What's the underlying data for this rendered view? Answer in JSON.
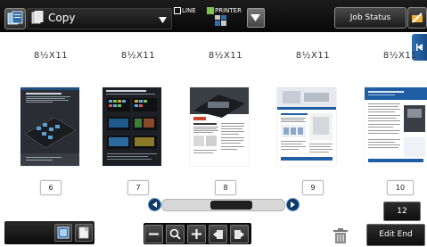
{
  "header": {
    "mode_label": "Copy",
    "line_label": "LINE",
    "printer_label": "PRINTER",
    "job_status_label": "Job Status"
  },
  "pages": [
    {
      "paper_size": "8½X11",
      "number": "6"
    },
    {
      "paper_size": "8½X11",
      "number": "7"
    },
    {
      "paper_size": "8½X11",
      "number": "8"
    },
    {
      "paper_size": "8½X11",
      "number": "9"
    },
    {
      "paper_size": "8½X11",
      "number": "10"
    }
  ],
  "pager": {
    "total_pages": "12",
    "scroll_position": 0.6
  },
  "footer": {
    "edit_end_label": "Edit End"
  },
  "colors": {
    "accent_blue": "#1f5ea3",
    "line_indicator": "#7ec44e"
  }
}
